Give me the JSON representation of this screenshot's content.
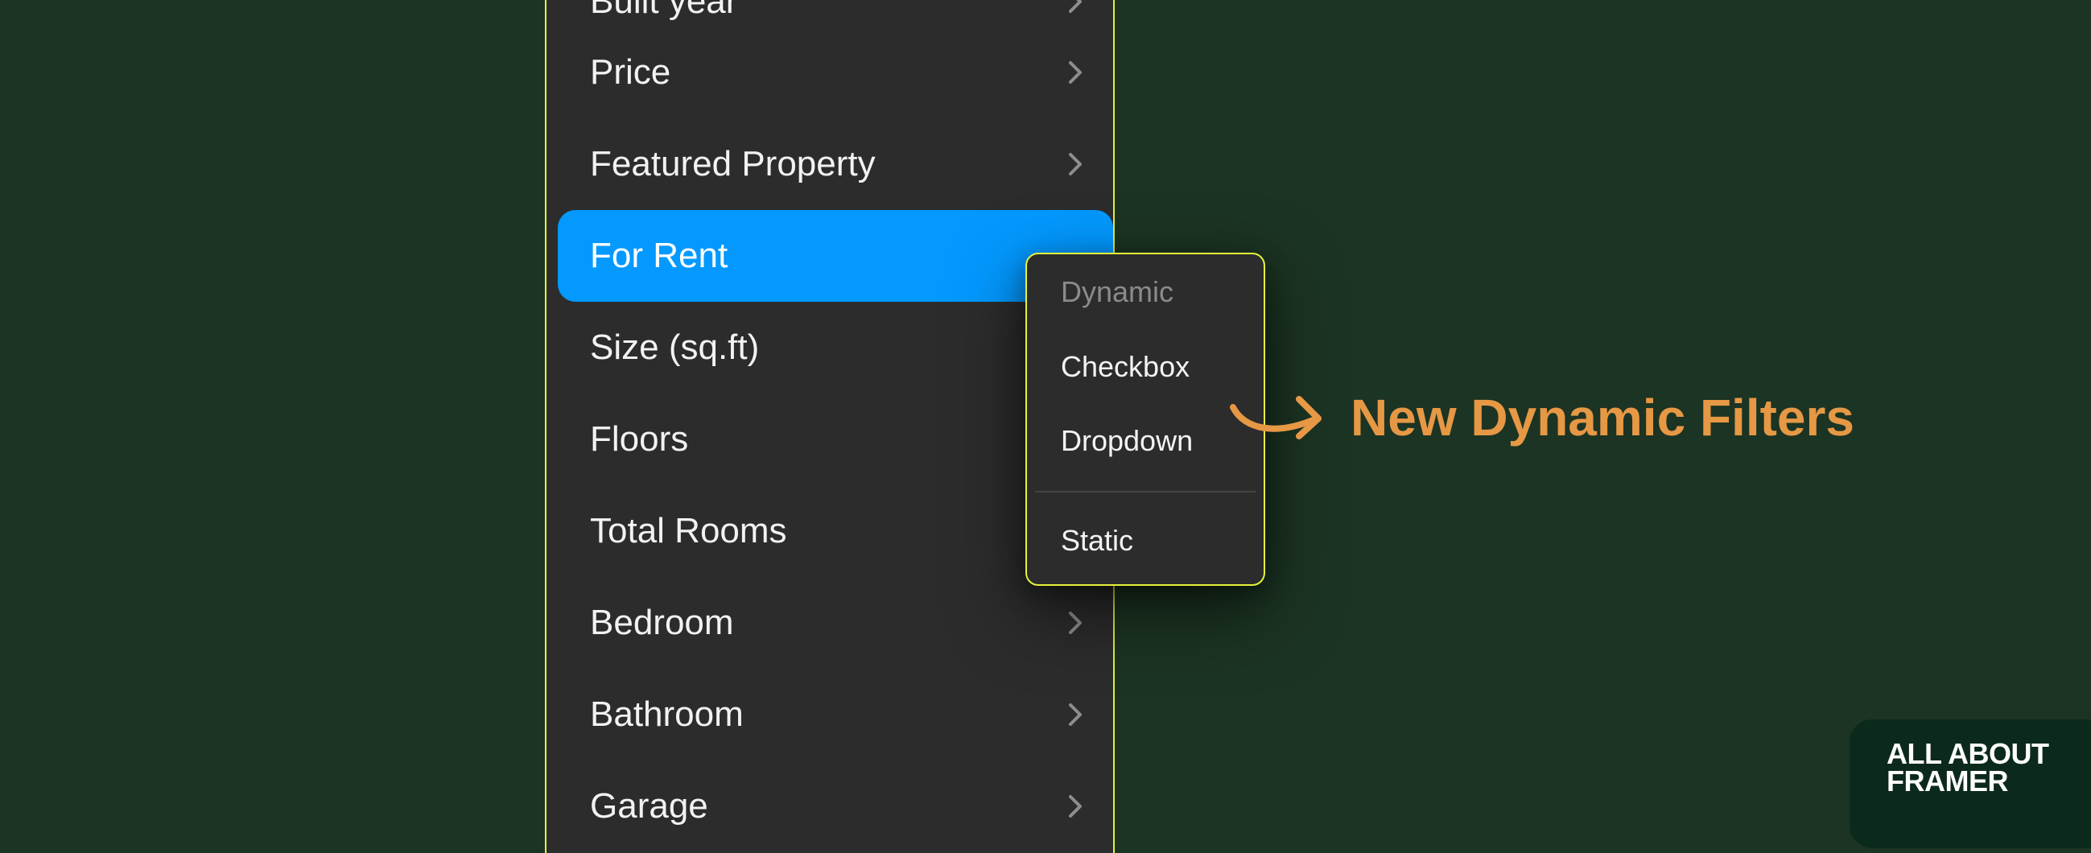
{
  "menu": {
    "items": [
      {
        "label": "Built year",
        "has_chevron": true
      },
      {
        "label": "Price",
        "has_chevron": true
      },
      {
        "label": "Featured Property",
        "has_chevron": true
      },
      {
        "label": "For Rent",
        "has_chevron": false,
        "active": true
      },
      {
        "label": "Size (sq.ft)",
        "has_chevron": false
      },
      {
        "label": "Floors",
        "has_chevron": false
      },
      {
        "label": "Total Rooms",
        "has_chevron": false
      },
      {
        "label": "Bedroom",
        "has_chevron": true
      },
      {
        "label": "Bathroom",
        "has_chevron": true
      },
      {
        "label": "Garage",
        "has_chevron": true
      }
    ],
    "chevron_icon": "chevron-right-icon"
  },
  "submenu": {
    "heading": "Dynamic",
    "options": [
      {
        "label": "Checkbox"
      },
      {
        "label": "Dropdown"
      },
      {
        "label": "Static"
      }
    ]
  },
  "annotation": {
    "text": "New Dynamic Filters",
    "icon": "curved-arrow-icon"
  },
  "brand": {
    "line1": "ALL ABOUT",
    "line2": "FRAMER"
  },
  "colors": {
    "background": "#1c3423",
    "panel": "#2c2c2c",
    "accent_border": "#e5f23a",
    "active_item": "#0399ff",
    "annotation": "#e69845",
    "badge": "#0c2a1c"
  }
}
